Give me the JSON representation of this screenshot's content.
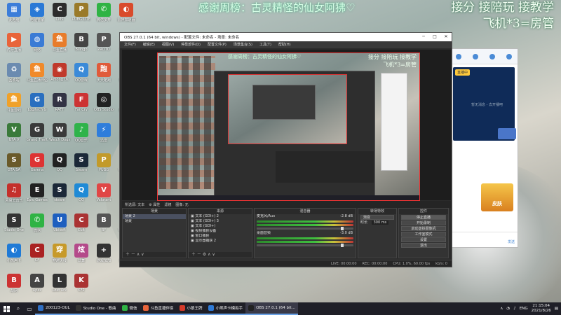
{
  "overlay": {
    "thanks_line": "感谢周榜：古灵精怪的仙女阿狒♡",
    "services_line": "接分 接陪玩 接教学",
    "plane_line": "飞机*3=房管"
  },
  "desktop_icons": [
    {
      "label": "此电脑",
      "color": "#3c7dd9",
      "glyph": "▦"
    },
    {
      "label": "电脑管家",
      "color": "#2a79d6",
      "glyph": "◈"
    },
    {
      "label": "CMS",
      "color": "#2d2d2d",
      "glyph": "C"
    },
    {
      "label": "PUBG LITE",
      "color": "#9a7a2a",
      "glyph": "P"
    },
    {
      "label": "微信多开",
      "color": "#2fb344",
      "glyph": "✆"
    },
    {
      "label": "雷神加速器",
      "color": "#d94b2b",
      "glyph": "◐"
    },
    {
      "label": "虎牙直播",
      "color": "#e8643a",
      "glyph": "▶"
    },
    {
      "label": "网络",
      "color": "#3a7bd5",
      "glyph": "◍"
    },
    {
      "label": "斗鱼直播",
      "color": "#e87c2a",
      "glyph": "鱼"
    },
    {
      "label": "Bilingo",
      "color": "#444",
      "glyph": "B"
    },
    {
      "label": "PROTO",
      "color": "#555",
      "glyph": "P"
    },
    {
      "label": "Solid Di",
      "color": "#3a3a3a",
      "glyph": "S"
    },
    {
      "label": "回收站",
      "color": "#6b8bb0",
      "glyph": "♻"
    },
    {
      "label": "斗鱼直播伴侣",
      "color": "#f08a2a",
      "glyph": "鱼"
    },
    {
      "label": "Among Us",
      "color": "#c0392b",
      "glyph": "◉"
    },
    {
      "label": "QQ游戏",
      "color": "#3a8ad8",
      "glyph": "Q"
    },
    {
      "label": "天天酷跑",
      "color": "#e05a3a",
      "glyph": "跑"
    },
    {
      "label": "控制面板",
      "color": "#3d77c7",
      "glyph": "◧"
    },
    {
      "label": "斗鱼游戏",
      "color": "#f0a12a",
      "glyph": "鱼"
    },
    {
      "label": "Logitech G",
      "color": "#2a6fbf",
      "glyph": "G"
    },
    {
      "label": "RAFT",
      "color": "#334",
      "glyph": "R"
    },
    {
      "label": "Far Cry",
      "color": "#c33",
      "glyph": "F"
    },
    {
      "label": "OBS Studio",
      "color": "#222",
      "glyph": "◎"
    },
    {
      "label": "腾讯游戏",
      "color": "#2a64c4",
      "glyph": "◆"
    },
    {
      "label": "GTA V",
      "color": "#3a7a3a",
      "glyph": "V"
    },
    {
      "label": "Grand Theft",
      "color": "#3a3a3a",
      "glyph": "G"
    },
    {
      "label": "Watch Dogs",
      "color": "#3a3a3a",
      "glyph": "W"
    },
    {
      "label": "QQ音乐",
      "color": "#2fb34a",
      "glyph": "♪"
    },
    {
      "label": "迅雷",
      "color": "#2f7ddb",
      "glyph": "⚡"
    },
    {
      "label": "Origin",
      "color": "#e8772a",
      "glyph": "O"
    },
    {
      "label": "GTA SA",
      "color": "#6a5a2a",
      "glyph": "S"
    },
    {
      "label": "Garena",
      "color": "#d33",
      "glyph": "G"
    },
    {
      "label": "QQ",
      "color": "#222",
      "glyph": "Q"
    },
    {
      "label": "Steam",
      "color": "#1b2838",
      "glyph": "S"
    },
    {
      "label": "PUBG",
      "color": "#c29a2a",
      "glyph": "P"
    },
    {
      "label": "WeGame",
      "color": "#b32",
      "glyph": "W"
    },
    {
      "label": "网易云音乐",
      "color": "#c4302b",
      "glyph": "♫"
    },
    {
      "label": "Epic Games",
      "color": "#222",
      "glyph": "E"
    },
    {
      "label": "steam",
      "color": "#1b2838",
      "glyph": "S"
    },
    {
      "label": "QQ",
      "color": "#1f8ad6",
      "glyph": "Q"
    },
    {
      "label": "Valorant",
      "color": "#e04646",
      "glyph": "V"
    },
    {
      "label": "HD",
      "color": "#666",
      "glyph": "H"
    },
    {
      "label": "Studio One",
      "color": "#333",
      "glyph": "S"
    },
    {
      "label": "微信",
      "color": "#2fb344",
      "glyph": "✆"
    },
    {
      "label": "Ubisoft",
      "color": "#1e5fbf",
      "glyph": "U"
    },
    {
      "label": "Cult",
      "color": "#a33",
      "glyph": "C"
    },
    {
      "label": "BF",
      "color": "#555",
      "glyph": "B"
    },
    {
      "label": "WeGame",
      "color": "#444",
      "glyph": "W"
    },
    {
      "label": "小熊声卡",
      "color": "#1f7ad6",
      "glyph": "◐"
    },
    {
      "label": "CF",
      "color": "#a22",
      "glyph": "C"
    },
    {
      "label": "穿越火线",
      "color": "#c79a2a",
      "glyph": "穿"
    },
    {
      "label": "炫舞",
      "color": "#b44a8a",
      "glyph": "炫"
    },
    {
      "label": "游戏加加",
      "color": "#333",
      "glyph": "+"
    },
    {
      "label": "英雄联盟",
      "color": "#3a6ac4",
      "glyph": "L"
    },
    {
      "label": "战网",
      "color": "#c33",
      "glyph": "B"
    },
    {
      "label": "Apex",
      "color": "#444",
      "glyph": "A"
    },
    {
      "label": "Lost Ark",
      "color": "#333",
      "glyph": "L"
    },
    {
      "label": "KF2",
      "color": "#a33",
      "glyph": "K"
    }
  ],
  "obs": {
    "title": "OBS 27.0.1 (64 bit, windows) - 配置文件: 未命名 - 场景: 未命名",
    "menu": [
      "文件(F)",
      "编辑(E)",
      "视图(V)",
      "停靠部件(D)",
      "配置文件(P)",
      "场景集合(S)",
      "工具(T)",
      "帮助(H)"
    ],
    "source_bar": [
      "所选源: 文本",
      "⚙ 属性",
      "滤镜",
      "图像: 无"
    ],
    "scenes_title": "场景",
    "scenes": [
      "场景 2",
      "场景"
    ],
    "sources_title": "来源",
    "sources": [
      "文本 (GDI+) 2",
      "文本 (GDI+) 3",
      "文本 (GDI+)",
      "视频捕获设备",
      "窗口捕获",
      "显示器捕获 2"
    ],
    "mixer_title": "混音器",
    "mixer": [
      {
        "name": "麦克风/Aux",
        "level": "-2.8 dB"
      },
      {
        "name": "桌面音频",
        "level": "-3.0 dB"
      }
    ],
    "transitions_title": "转场特效",
    "transition": "渐变",
    "duration_label": "时长",
    "duration": "300 ms",
    "controls_title": "控件",
    "controls": [
      "停止直播",
      "开始录制",
      "启动虚拟摄像机",
      "工作室模式",
      "设置",
      "退出"
    ],
    "status": [
      "LIVE: 00:00:00",
      "REC: 00:00:00",
      "CPU: 1.0%, 60.00 fps",
      "kb/s: 0"
    ]
  },
  "right_app": {
    "badge": "直播中",
    "notice": "暂无消息 - 去开播吧",
    "promo_label": "皮肤",
    "send_label": "发送"
  },
  "taskbar": {
    "tasks": [
      {
        "label": "200123-OUL",
        "color": "#2f6fc4"
      },
      {
        "label": "Studio One - 歌曲",
        "color": "#333"
      },
      {
        "label": "微信",
        "color": "#2fb344"
      },
      {
        "label": "斗鱼直播伴侣",
        "color": "#e8643a"
      },
      {
        "label": "小狼王牌",
        "color": "#d53a2a"
      },
      {
        "label": "小熊声卡模拟手",
        "color": "#2f7ad6"
      },
      {
        "label": "OBS 27.0.1 (64 bit...",
        "color": "#222"
      }
    ],
    "lang": "ENG",
    "time": "21:15:04",
    "date": "2021/8/26"
  }
}
